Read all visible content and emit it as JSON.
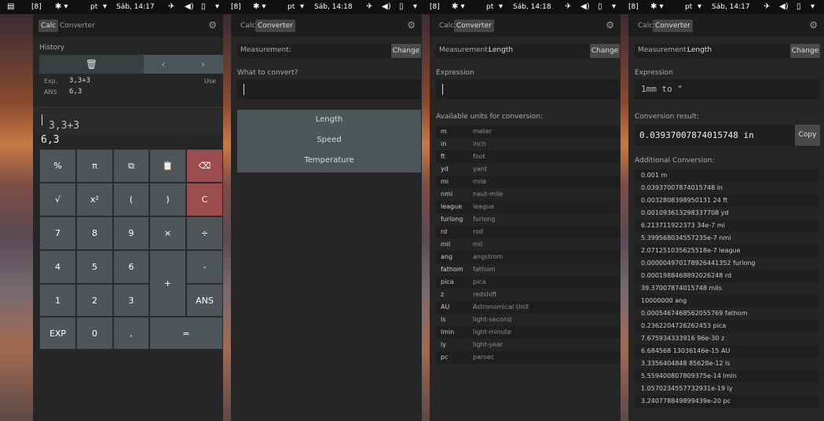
{
  "statusbars": [
    {
      "ws": "[8]",
      "lang": "pt",
      "clock": "Sáb, 14:17"
    },
    {
      "ws": "[8]",
      "lang": "pt",
      "clock": "Sáb, 14:18"
    },
    {
      "ws": "[8]",
      "lang": "pt",
      "clock": "Sáb, 14:18"
    },
    {
      "ws": "[8]",
      "lang": "pt",
      "clock": "Sáb, 14:17"
    }
  ],
  "tabs": {
    "calc": "Calc",
    "converter": "Converter"
  },
  "p1": {
    "history_label": "History",
    "expr_label": "Exp.",
    "expr_value": "3,3+3",
    "use_label": "Use",
    "ans_label": "ANS",
    "ans_value": "6,3",
    "input": "3,3+3",
    "result": "6,3",
    "keys": [
      [
        "%",
        "π",
        "⧉",
        "📋",
        "⌫"
      ],
      [
        "√",
        "x²",
        "(",
        ")",
        "C"
      ],
      [
        "7",
        "8",
        "9",
        "×",
        "÷"
      ],
      [
        "4",
        "5",
        "6",
        "+",
        "-"
      ],
      [
        "1",
        "2",
        "3",
        "ANS"
      ],
      [
        "EXP",
        "0",
        ",",
        "="
      ]
    ]
  },
  "p2": {
    "measurement_label": "Measurement:",
    "measurement_value": "",
    "change": "Change",
    "question": "What to convert?",
    "options": [
      "Length",
      "Speed",
      "Temperature"
    ]
  },
  "p3": {
    "measurement_label": "Measurement:",
    "measurement_value": "Length",
    "change": "Change",
    "expression_label": "Expression",
    "units_label": "Available units for conversion:",
    "units": [
      {
        "a": "m",
        "b": "meter"
      },
      {
        "a": "in",
        "b": "inch"
      },
      {
        "a": "ft",
        "b": "foot"
      },
      {
        "a": "yd",
        "b": "yard"
      },
      {
        "a": "mi",
        "b": "mile"
      },
      {
        "a": "nmi",
        "b": "naut-mile"
      },
      {
        "a": "league",
        "b": "league"
      },
      {
        "a": "furlong",
        "b": "furlong"
      },
      {
        "a": "rd",
        "b": "rod"
      },
      {
        "a": "mil",
        "b": "mil"
      },
      {
        "a": "ang",
        "b": "angstrom"
      },
      {
        "a": "fathom",
        "b": "fathom"
      },
      {
        "a": "pica",
        "b": "pica"
      },
      {
        "a": "z",
        "b": "redshift"
      },
      {
        "a": "AU",
        "b": "Astronomical Unit"
      },
      {
        "a": "ls",
        "b": "light-second"
      },
      {
        "a": "lmin",
        "b": "light-minute"
      },
      {
        "a": "ly",
        "b": "light-year"
      },
      {
        "a": "pc",
        "b": "parsec"
      }
    ]
  },
  "p4": {
    "measurement_label": "Measurement:",
    "measurement_value": "Length",
    "change": "Change",
    "expression_label": "Expression",
    "expression_value": "1mm to \"",
    "result_label": "Conversion result:",
    "result_value": "0.03937007874015748 in",
    "copy": "Copy",
    "additional_label": "Additional Conversion:",
    "conversions": [
      "0.001 m",
      "0.03937007874015748 in",
      "0.0032808398950131 24 ft",
      "0.001093613298337708 yd",
      "6.213711922373 34e-7 mi",
      "5.399568034557235e-7 nmi",
      "2.071251035625518e-7 league",
      "0.000004970178926441352 furlong",
      "0.0001988468892026248 rd",
      "39.37007874015748 mils",
      "10000000 ang",
      "0.0005467468562055769 fathom",
      "0.2362204726262453 pica",
      "7.675934333916 96e-30 z",
      "6.684568 13036146e-15 AU",
      "3.3356404848 85628e-12 ls",
      "5.559400807809375e-14 lmin",
      "1.0570234557732931e-19 ly",
      "3.240778849899439e-20 pc"
    ]
  }
}
